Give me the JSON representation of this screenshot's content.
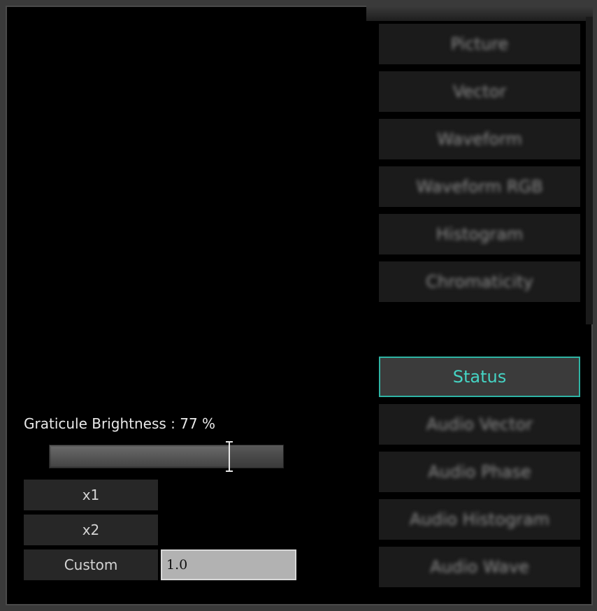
{
  "scope_buttons": [
    {
      "label": "Picture",
      "active": false
    },
    {
      "label": "Vector",
      "active": false
    },
    {
      "label": "Waveform",
      "active": false
    },
    {
      "label": "Waveform RGB",
      "active": false
    },
    {
      "label": "Histogram",
      "active": false
    },
    {
      "label": "Chromaticity",
      "active": false
    }
  ],
  "info_buttons": [
    {
      "label": "Status",
      "active": true
    },
    {
      "label": "Audio Vector",
      "active": false
    },
    {
      "label": "Audio Phase",
      "active": false
    },
    {
      "label": "Audio Histogram",
      "active": false
    },
    {
      "label": "Audio Wave",
      "active": false
    }
  ],
  "graticule": {
    "label": "Graticule Brightness : 77 %",
    "brightness_percent": 77
  },
  "zoom": {
    "x1_label": "x1",
    "x2_label": "x2",
    "custom_label": "Custom",
    "custom_value": "1.0"
  },
  "colors": {
    "accent": "#2fb4a4",
    "active_text": "#45d4c4",
    "background": "#000000"
  }
}
